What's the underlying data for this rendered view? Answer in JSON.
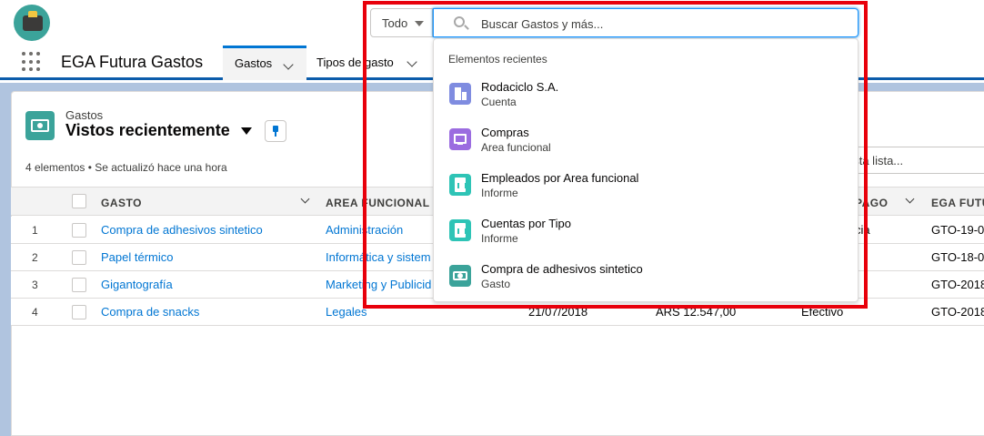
{
  "header": {
    "search_scope": "Todo",
    "search_placeholder": "Buscar Gastos y más..."
  },
  "nav": {
    "app_name": "EGA Futura Gastos",
    "tabs": [
      {
        "label": "Gastos",
        "active": true
      },
      {
        "label": "Tipos de gasto",
        "active": false
      }
    ]
  },
  "list": {
    "object_label": "Gastos",
    "view_title": "Vistos recientemente",
    "meta": "4 elementos • Se actualizó hace una hora",
    "search_fragment": "esta lista...",
    "columns": [
      "GASTO",
      "AREA FUNCIONAL",
      "PAGO",
      "EGA FUTU"
    ],
    "rows": [
      {
        "num": "1",
        "gasto": "Compra de adhesivos sintetico",
        "area": "Administración",
        "pago": "cia",
        "ega": "GTO-19-0"
      },
      {
        "num": "2",
        "gasto": "Papel térmico",
        "area": "Informática y sistem",
        "pago": "",
        "ega": "GTO-18-0"
      },
      {
        "num": "3",
        "gasto": "Gigantografía",
        "area": "Marketing y Publicid",
        "pago": "",
        "ega": "GTO-2018"
      },
      {
        "num": "4",
        "gasto": "Compra de snacks",
        "area": "Legales",
        "fecha": "21/07/2018",
        "importe": "ARS 12.547,00",
        "pago": "Efectivo",
        "ega": "GTO-2018"
      }
    ]
  },
  "dropdown": {
    "heading": "Elementos recientes",
    "items": [
      {
        "title": "Rodaciclo S.A.",
        "subtitle": "Cuenta",
        "icon": "building-icon",
        "color": "#7f8ce0"
      },
      {
        "title": "Compras",
        "subtitle": "Area funcional",
        "icon": "monitor-icon",
        "color": "#9b6ce0"
      },
      {
        "title": "Empleados por Area funcional",
        "subtitle": "Informe",
        "icon": "report-icon",
        "color": "#2ec4b6"
      },
      {
        "title": "Cuentas por Tipo",
        "subtitle": "Informe",
        "icon": "report-icon",
        "color": "#2ec4b6"
      },
      {
        "title": "Compra de adhesivos sintetico",
        "subtitle": "Gasto",
        "icon": "money-icon",
        "color": "#3ba39a"
      }
    ]
  },
  "colors": {
    "brand_blue": "#0176d3",
    "highlight_red": "#e8000b",
    "nav_border": "#0b5cab"
  }
}
